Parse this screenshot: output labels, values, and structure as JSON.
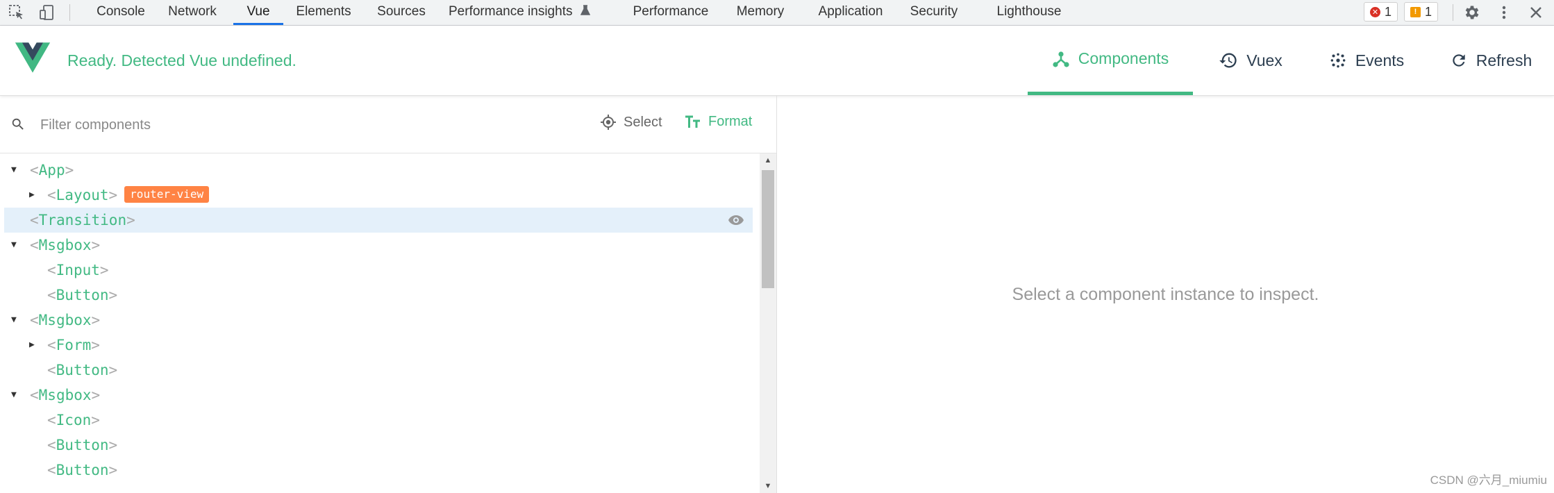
{
  "devtools": {
    "tabs": [
      "Console",
      "Network",
      "Vue",
      "Elements",
      "Sources",
      "Performance insights",
      "Performance",
      "Memory",
      "Application",
      "Security",
      "Lighthouse"
    ],
    "active_tab": "Vue",
    "error_count": "1",
    "warning_count": "1",
    "colors": {
      "active_underline": "#1a73e8",
      "error": "#d93025",
      "warning": "#f29900"
    },
    "icons": [
      "inspect-icon",
      "device-toggle-icon",
      "flask-icon",
      "gear-icon",
      "more-vert-icon",
      "close-icon"
    ]
  },
  "vue": {
    "status": "Ready. Detected Vue undefined.",
    "tabs": [
      {
        "label": "Components",
        "icon": "components-icon",
        "active": true
      },
      {
        "label": "Vuex",
        "icon": "history-icon",
        "active": false
      },
      {
        "label": "Events",
        "icon": "events-icon",
        "active": false
      },
      {
        "label": "Refresh",
        "icon": "refresh-icon",
        "active": false
      }
    ],
    "accent_color": "#42b983"
  },
  "filter": {
    "placeholder": "Filter components",
    "select_label": "Select",
    "format_label": "Format"
  },
  "tree": [
    {
      "name": "App",
      "expanded": true
    },
    {
      "name": "Layout",
      "collapsed": true,
      "badge": "router-view"
    },
    {
      "name": "Transition",
      "selected": true
    },
    {
      "name": "Msgbox",
      "expanded": true
    },
    {
      "name": "Input"
    },
    {
      "name": "Button"
    },
    {
      "name": "Msgbox",
      "expanded": true
    },
    {
      "name": "Form",
      "collapsed": true
    },
    {
      "name": "Button"
    },
    {
      "name": "Msgbox",
      "expanded": true
    },
    {
      "name": "Icon"
    },
    {
      "name": "Button"
    },
    {
      "name": "Button"
    }
  ],
  "inspector": {
    "empty_message": "Select a component instance to inspect."
  },
  "watermark": "CSDN @六月_miumiu"
}
